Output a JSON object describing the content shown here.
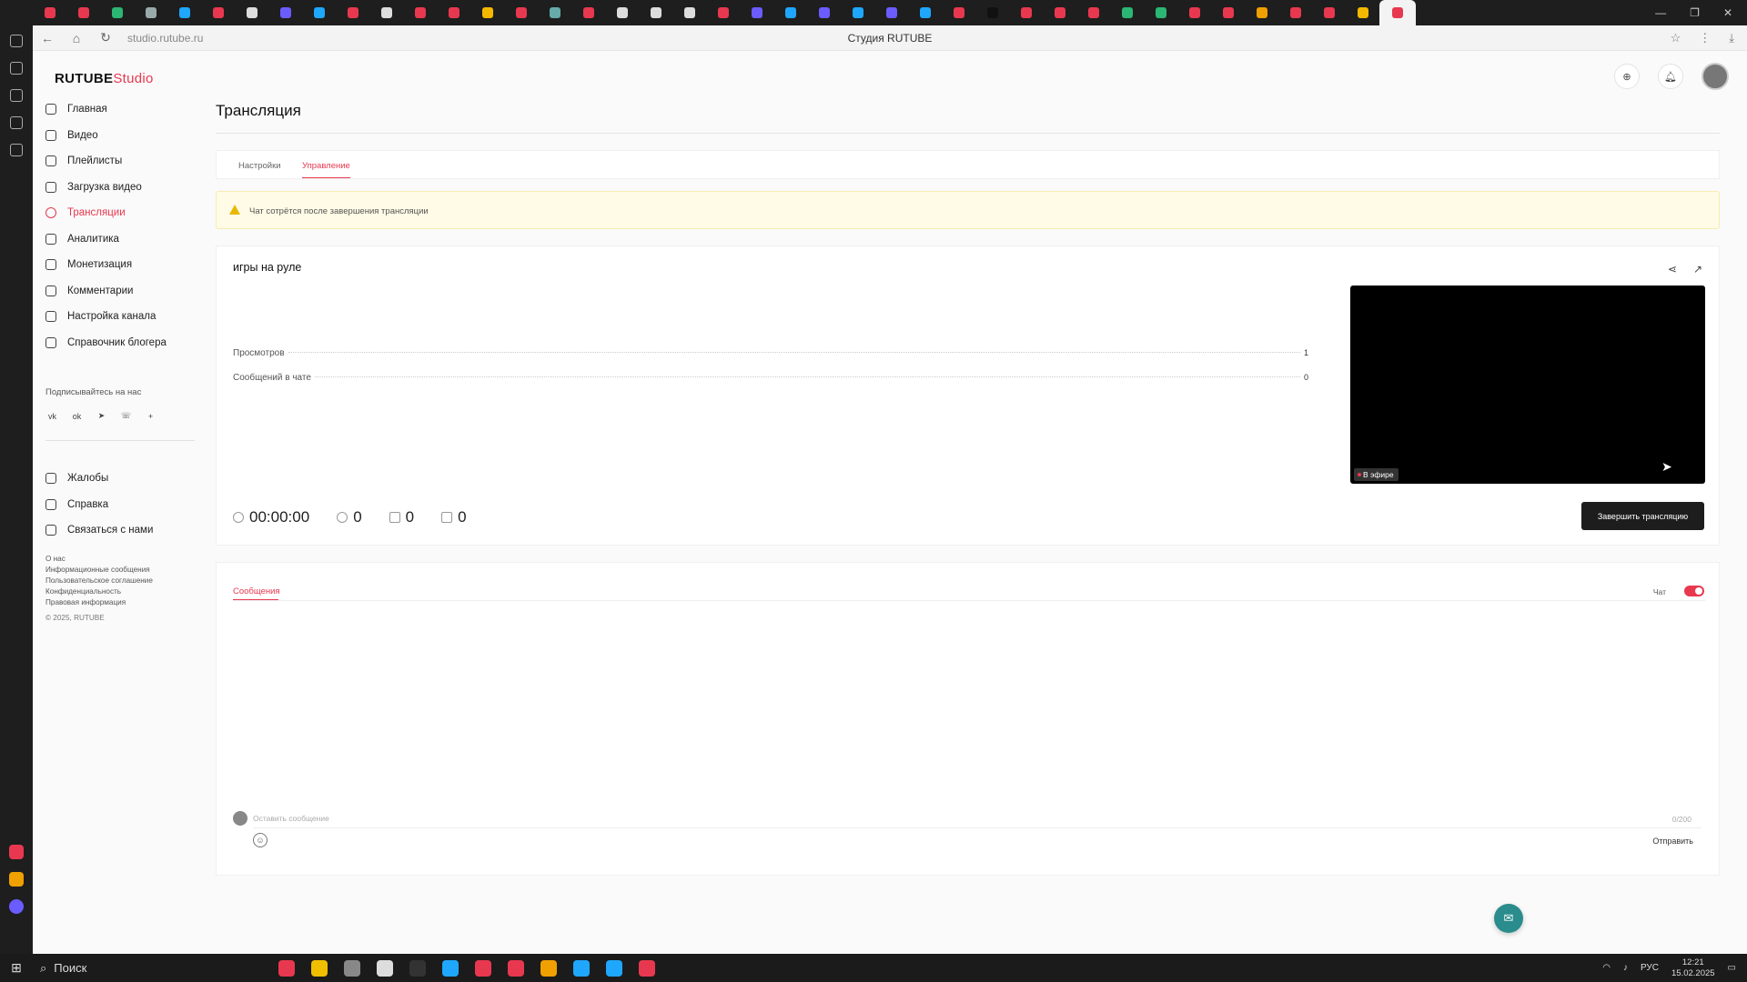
{
  "browser": {
    "url": "studio.rutube.ru",
    "page_title": "Студия RUTUBE",
    "tab_colors": [
      "#e8384f",
      "#e8384f",
      "#2bb673",
      "#9aa",
      "#1ea7fd",
      "#e8384f",
      "#ddd",
      "#6a5cff",
      "#1ea7fd",
      "#e8384f",
      "#ddd",
      "#e8384f",
      "#e8384f",
      "#f5b800",
      "#e8384f",
      "#6aa",
      "#e8384f",
      "#ddd",
      "#ddd",
      "#ddd",
      "#e8384f",
      "#6a5cff",
      "#1ea7fd",
      "#6a5cff",
      "#1ea7fd",
      "#6a5cff",
      "#1ea7fd",
      "#e8384f",
      "#111",
      "#e8384f",
      "#e8384f",
      "#e8384f",
      "#2bb673",
      "#2bb673",
      "#e8384f",
      "#e8384f",
      "#f0a000",
      "#e8384f",
      "#e8384f",
      "#f5b800",
      "#e8384f"
    ]
  },
  "logo": {
    "main": "RUTUBE",
    "accent": "Studio"
  },
  "sidebar": {
    "items": [
      {
        "label": "Главная",
        "icon": "home-icon"
      },
      {
        "label": "Видео",
        "icon": "video-icon"
      },
      {
        "label": "Плейлисты",
        "icon": "playlist-icon"
      },
      {
        "label": "Загрузка видео",
        "icon": "upload-icon"
      },
      {
        "label": "Трансляции",
        "icon": "broadcast-icon"
      },
      {
        "label": "Аналитика",
        "icon": "analytics-icon"
      },
      {
        "label": "Монетизация",
        "icon": "monetization-icon"
      },
      {
        "label": "Комментарии",
        "icon": "comments-icon"
      },
      {
        "label": "Настройка канала",
        "icon": "gear-icon"
      },
      {
        "label": "Справочник блогера",
        "icon": "info-icon"
      }
    ],
    "subscribe_label": "Подписывайтесь на нас",
    "socials": [
      "vk-icon",
      "ok-icon",
      "telegram-icon",
      "viber-icon",
      "plus-icon"
    ],
    "bottom_items": [
      {
        "label": "Жалобы",
        "icon": "flag-icon"
      },
      {
        "label": "Справка",
        "icon": "help-icon"
      },
      {
        "label": "Связаться с нами",
        "icon": "mail-icon"
      }
    ],
    "footer_links": [
      "О нас",
      "Информационные сообщения",
      "Пользовательское соглашение",
      "Конфиденциальность",
      "Правовая информация"
    ],
    "copyright": "© 2025, RUTUBE"
  },
  "main": {
    "page_title": "Трансляция",
    "tabs": [
      "Настройки",
      "Управление"
    ],
    "active_tab": "Управление",
    "warning": "Чат сотрётся после завершения трансляции",
    "stream": {
      "name": "игры на руле",
      "stats": [
        {
          "label": "Просмотров",
          "value": "1"
        },
        {
          "label": "Сообщений в чате",
          "value": "0"
        }
      ],
      "timer": "00:00:00",
      "viewers": "0",
      "likes": "0",
      "dislikes": "0",
      "live_badge": "В эфире",
      "end_button": "Завершить трансляцию"
    },
    "chat": {
      "tab": "Сообщения",
      "toggle_label": "Чат",
      "toggle_on": true,
      "input_placeholder": "Оставить сообщение",
      "char_count": "0/200",
      "send_label": "Отправить"
    }
  },
  "taskbar": {
    "search": "Поиск",
    "lang": "РУС",
    "time": "12:21",
    "date": "15.02.2025",
    "app_colors": [
      "#e8384f",
      "#f0c000",
      "#888",
      "#ddd",
      "#333",
      "#1ea7fd",
      "#e8384f",
      "#e8384f",
      "#f0a000",
      "#1ea7fd",
      "#1ea7fd",
      "#e8384f"
    ]
  },
  "colors": {
    "accent": "#e8384f",
    "warning_bg": "#fffbe6"
  }
}
